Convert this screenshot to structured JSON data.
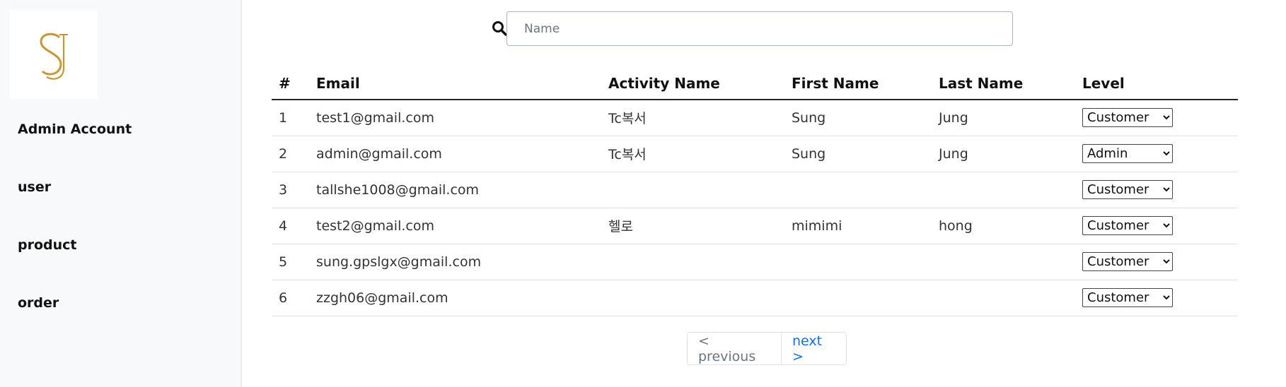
{
  "sidebar": {
    "logo_text": "SJ",
    "items": [
      {
        "label": "Admin Account"
      },
      {
        "label": "user"
      },
      {
        "label": "product"
      },
      {
        "label": "order"
      }
    ]
  },
  "search": {
    "placeholder": "Name",
    "value": "",
    "icon": "search-icon"
  },
  "table": {
    "columns": [
      "#",
      "Email",
      "Activity Name",
      "First Name",
      "Last Name",
      "Level"
    ],
    "rows": [
      {
        "num": "1",
        "email": "test1@gmail.com",
        "activity": "Tc복서",
        "first": "Sung",
        "last": "Jung",
        "level": "Customer"
      },
      {
        "num": "2",
        "email": "admin@gmail.com",
        "activity": "Tc복서",
        "first": "Sung",
        "last": "Jung",
        "level": "Admin"
      },
      {
        "num": "3",
        "email": "tallshe1008@gmail.com",
        "activity": "",
        "first": "",
        "last": "",
        "level": "Customer"
      },
      {
        "num": "4",
        "email": "test2@gmail.com",
        "activity": "헬로",
        "first": "mimimi",
        "last": "hong",
        "level": "Customer"
      },
      {
        "num": "5",
        "email": "sung.gpslgx@gmail.com",
        "activity": "",
        "first": "",
        "last": "",
        "level": "Customer"
      },
      {
        "num": "6",
        "email": "zzgh06@gmail.com",
        "activity": "",
        "first": "",
        "last": "",
        "level": "Customer"
      }
    ],
    "level_options": [
      "Customer",
      "Admin"
    ]
  },
  "pagination": {
    "prev_label": "< previous",
    "next_label": "next >"
  },
  "colors": {
    "brand_gold": "#c9962f",
    "link_blue": "#0d6efd",
    "sidebar_bg": "#f8f9fa"
  }
}
